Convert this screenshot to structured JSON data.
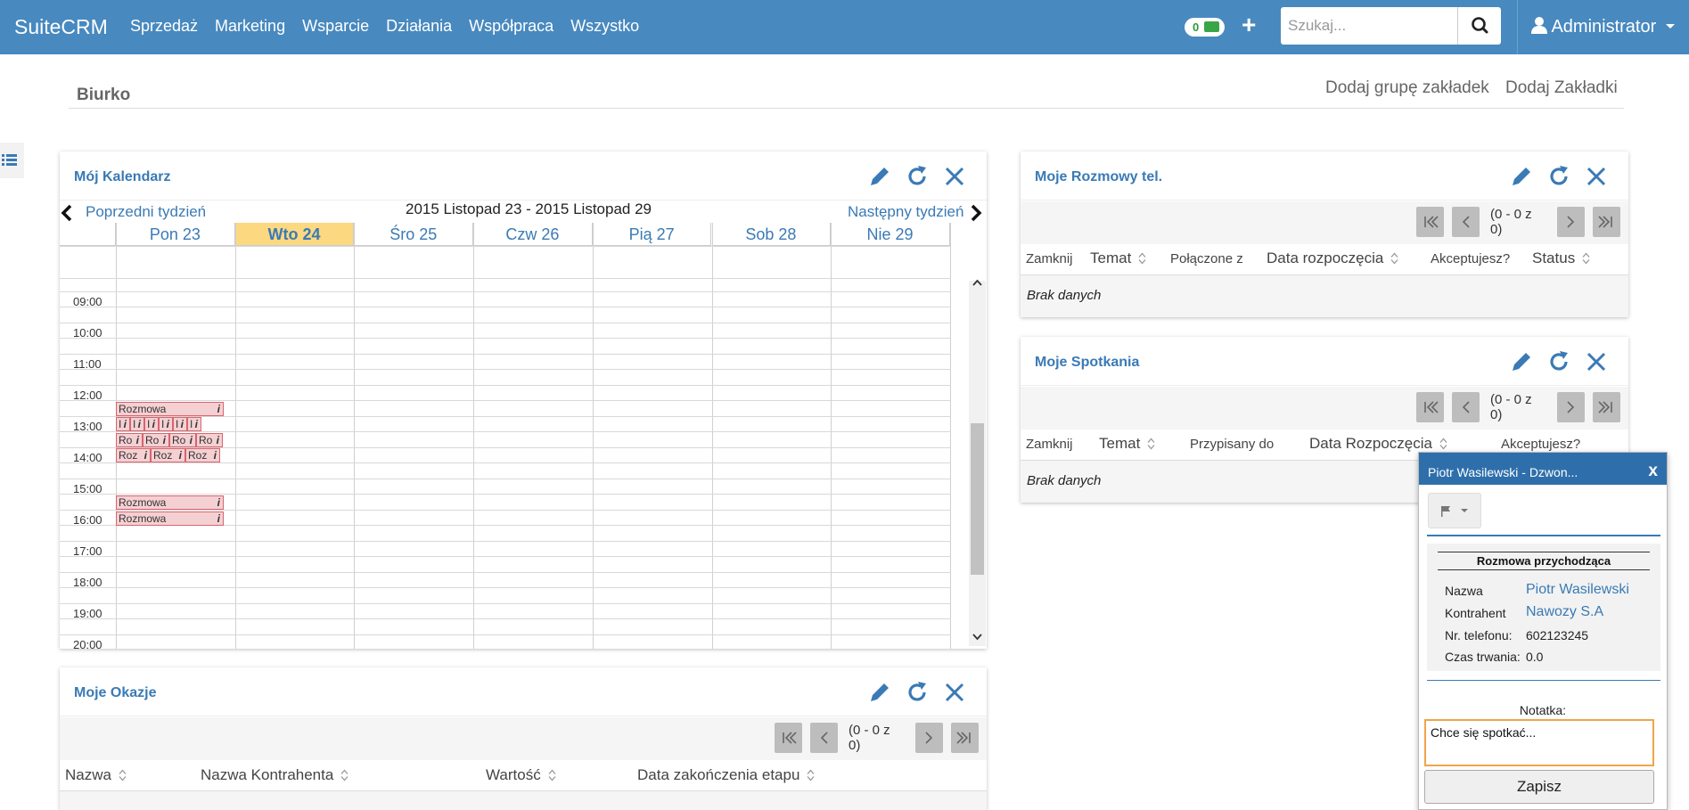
{
  "nav": {
    "brand": "SuiteCRM",
    "menu": [
      "Sprzedaż",
      "Marketing",
      "Wsparcie",
      "Działania",
      "Współpraca",
      "Wszystko"
    ],
    "notification_count": "0",
    "search_placeholder": "Szukaj...",
    "user": "Administrator"
  },
  "page": {
    "title": "Biurko",
    "add_tab_group": "Dodaj grupę zakładek",
    "add_tabs": "Dodaj Zakładki"
  },
  "calendar": {
    "title": "Mój Kalendarz",
    "prev": "Poprzedni tydzień",
    "range": "2015 Listopad 23 - 2015 Listopad 29",
    "next": "Następny tydzień",
    "days": [
      {
        "label": "Pon 23",
        "today": false
      },
      {
        "label": "Wto 24",
        "today": true
      },
      {
        "label": "Śro 25",
        "today": false
      },
      {
        "label": "Czw 26",
        "today": false
      },
      {
        "label": "Pią 27",
        "today": false
      },
      {
        "label": "Sob 28",
        "today": false
      },
      {
        "label": "Nie 29",
        "today": false
      }
    ],
    "times": [
      "09:00",
      "10:00",
      "11:00",
      "12:00",
      "13:00",
      "14:00",
      "15:00",
      "16:00",
      "17:00",
      "18:00",
      "19:00",
      "20:00"
    ],
    "events": {
      "rozmowa_1200": "Rozmowa",
      "short_13": "I",
      "short_1330": "Ro",
      "short_14": "Roz",
      "rozmowa_1530": "Rozmowa",
      "rozmowa_1600": "Rozmowa",
      "info": "i"
    }
  },
  "calls": {
    "title": "Moje Rozmowy tel.",
    "pager": "(0 - 0 z 0)",
    "columns": [
      "Zamknij",
      "Temat",
      "Połączone z",
      "Data rozpoczęcia",
      "Akceptujesz?",
      "Status"
    ],
    "empty": "Brak danych"
  },
  "meetings": {
    "title": "Moje Spotkania",
    "pager": "(0 - 0 z 0)",
    "columns": [
      "Zamknij",
      "Temat",
      "Przypisany do",
      "Data Rozpoczęcia",
      "Akceptujesz?"
    ],
    "empty": "Brak danych"
  },
  "opportunities": {
    "title": "Moje Okazje",
    "pager": "(0 - 0 z 0)",
    "columns": [
      "Nazwa",
      "Nazwa Kontrahenta",
      "Wartość",
      "Data zakończenia etapu"
    ]
  },
  "popup": {
    "title": "Piotr Wasilewski - Dzwon...",
    "close": "x",
    "heading": "Rozmowa przychodząca",
    "fields": [
      {
        "label": "Nazwa",
        "value": "Piotr Wasilewski"
      },
      {
        "label": "Kontrahent",
        "value": "Nawozy S.A"
      },
      {
        "label": "Nr. telefonu:",
        "value": "602123245"
      },
      {
        "label": "Czas trwania:",
        "value": "0.0"
      }
    ],
    "note_label": "Notatka:",
    "note_value": "Chce się spotkać...",
    "save": "Zapisz"
  },
  "colors": {
    "nav": "#4889bf",
    "link": "#3a7ab5",
    "today": "#fcd881",
    "event_bg": "#f5d0d3",
    "event_border": "#d9646e"
  }
}
